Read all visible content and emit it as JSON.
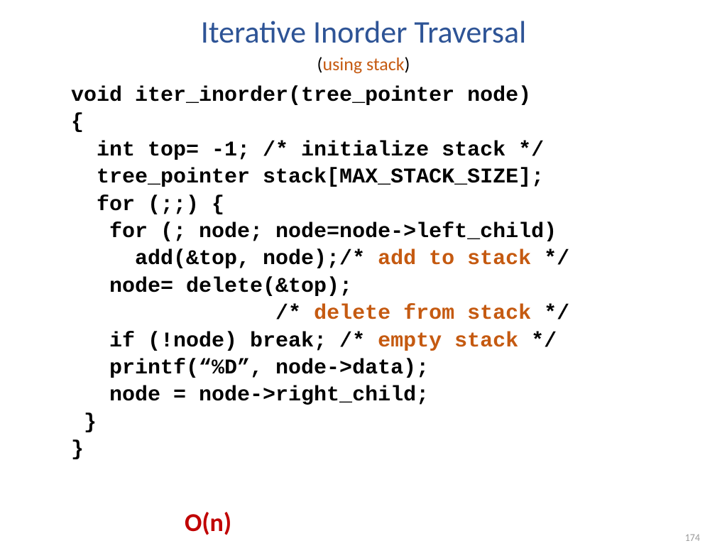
{
  "title": "Iterative Inorder Traversal",
  "subtitle": {
    "open": "(",
    "inner": "using stack",
    "close": ")"
  },
  "code": {
    "l1": "void iter_inorder(tree_pointer node)",
    "l2": "{",
    "l3": "  int top= -1; /* initialize stack */",
    "l4": "  tree_pointer stack[MAX_STACK_SIZE];",
    "l5": "  for (;;) {",
    "l6": "   for (; node; node=node->left_child)",
    "l7a": "     add(&top, node);/* ",
    "l7b": "add to stack",
    "l7c": " */",
    "l8": "   node= delete(&top);",
    "l9a": "                /* ",
    "l9b": "delete from stack",
    "l9c": " */",
    "l10a": "   if (!node) break; /* ",
    "l10b": "empty stack",
    "l10c": " */",
    "l11": "   printf(“%D”, node->data);",
    "l12": "   node = node->right_child;",
    "l13": " }",
    "l14": "}"
  },
  "complexity": "O(n)",
  "page": "174"
}
